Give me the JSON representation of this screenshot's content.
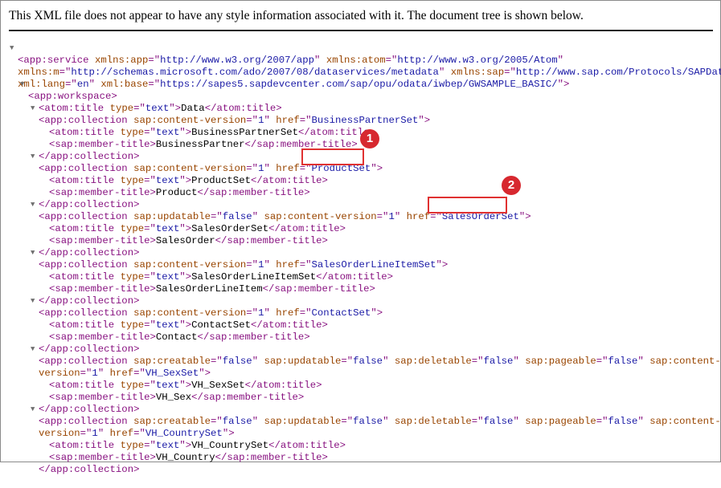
{
  "notice": "This XML file does not appear to have any style information associated with it. The document tree is shown below.",
  "xml": {
    "service_open_l1": "app:service",
    "ns_app_attr": "xmlns:app",
    "ns_app_val": "http://www.w3.org/2007/app",
    "ns_atom_attr": "xmlns:atom",
    "ns_atom_val": "http://www.w3.org/2005/Atom",
    "ns_m_attr": "xmlns:m",
    "ns_m_val": "http://schemas.microsoft.com/ado/2007/08/dataservices/metadata",
    "ns_sap_attr": "xmlns:sap",
    "ns_sap_val": "http://www.sap.com/Protocols/SAPData",
    "lang_attr": "xml:lang",
    "lang_val": "en",
    "base_attr": "xml:base",
    "base_val": "https://sapes5.sapdevcenter.com/sap/opu/odata/iwbep/GWSAMPLE_BASIC/",
    "workspace": "app:workspace",
    "ws_title_text": "Data",
    "collections": [
      {
        "href": "BusinessPartnerSet",
        "title": "BusinessPartnerSet",
        "member": "BusinessPartner"
      },
      {
        "href": "ProductSet",
        "title": "ProductSet",
        "member": "Product"
      },
      {
        "href": "SalesOrderSet",
        "title": "SalesOrderSet",
        "member": "SalesOrder"
      },
      {
        "href": "SalesOrderLineItemSet",
        "title": "SalesOrderLineItemSet",
        "member": "SalesOrderLineItem"
      },
      {
        "href": "ContactSet",
        "title": "ContactSet",
        "member": "Contact"
      },
      {
        "href": "VH_SexSet",
        "title": "VH_SexSet",
        "member": "VH_Sex"
      },
      {
        "href": "VH_CountrySet",
        "title": "VH_CountrySet",
        "member": "VH_Country"
      }
    ],
    "false": "false",
    "one": "1",
    "text": "text"
  },
  "markers": {
    "m1": "1",
    "m2": "2"
  }
}
